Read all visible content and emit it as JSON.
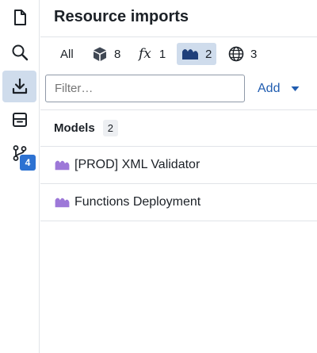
{
  "panel": {
    "title": "Resource imports"
  },
  "tabs": [
    {
      "label": "All",
      "icon": "none"
    },
    {
      "label": "8",
      "icon": "cube-icon"
    },
    {
      "label": "1",
      "icon": "function-icon",
      "symbol": "fx"
    },
    {
      "label": "2",
      "icon": "model-icon",
      "selected": true
    },
    {
      "label": "3",
      "icon": "globe-icon"
    }
  ],
  "filter": {
    "placeholder": "Filter…"
  },
  "add_button": {
    "label": "Add"
  },
  "sidebar": {
    "branch_badge": "4"
  },
  "section": {
    "title": "Models",
    "count": "2"
  },
  "items": [
    {
      "label": "[PROD] XML Validator"
    },
    {
      "label": "Functions Deployment"
    }
  ],
  "colors": {
    "accent": "#2d72d2",
    "selected_bg": "#cfdcec",
    "model_icon": "#9d78d8",
    "link": "#215db0"
  }
}
